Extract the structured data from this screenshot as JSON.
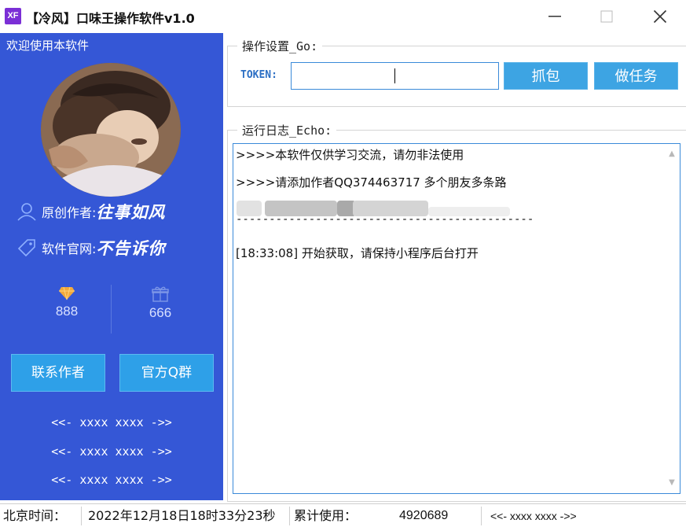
{
  "window": {
    "icon_text": "XF",
    "title": "【冷风】口味王操作软件v1.0"
  },
  "sidebar": {
    "welcome": "欢迎使用本软件",
    "author_label": "原创作者:",
    "author_value": "往事如风",
    "site_label": "软件官网:",
    "site_value": "不告诉你",
    "stats": [
      {
        "icon": "diamond-icon",
        "value": "888"
      },
      {
        "icon": "gift-icon",
        "value": "666"
      }
    ],
    "buttons": {
      "contact": "联系作者",
      "group": "官方Q群"
    },
    "placeholders": [
      "<<- xxxx xxxx ->>",
      "<<- xxxx xxxx ->>",
      "<<- xxxx xxxx ->>"
    ]
  },
  "settings": {
    "legend": "操作设置_Go:",
    "token_label": "TOKEN:",
    "token_value": "",
    "capture_button": "抓包",
    "task_button": "做任务"
  },
  "log": {
    "legend": "运行日志_Echo:",
    "lines": [
      ">>>>本软件仅供学习交流，请勿非法使用",
      ">>>>请添加作者QQ374463717 多个朋友多条路",
      "---------------------------------------------",
      "[18:33:08]  开始获取，请保持小程序后台打开"
    ]
  },
  "status": {
    "time_label": "北京时间：",
    "time_value": "2022年12月18日18时33分23秒",
    "used_label": "累计使用：",
    "used_value": "4920689",
    "extra": "<<- xxxx xxxx ->>"
  },
  "colors": {
    "sidebar_bg": "#3557d6",
    "button_bg": "#3da4e3",
    "input_border": "#3a8ad9",
    "token_label": "#2c6fc4"
  }
}
